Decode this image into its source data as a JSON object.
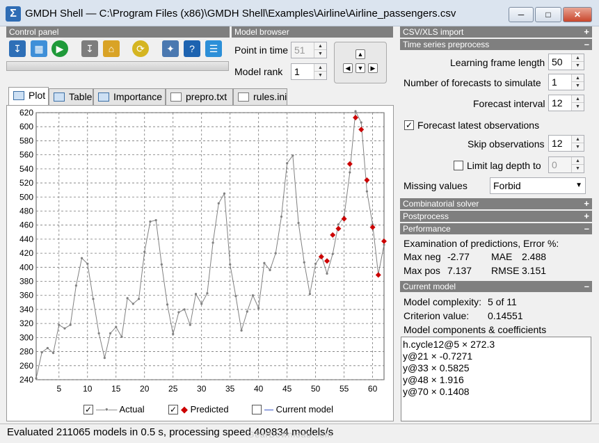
{
  "window": {
    "title": "GMDH Shell — C:\\Program Files (x86)\\GMDH Shell\\Examples\\Airline\\Airline_passengers.csv",
    "app_icon": "Σ"
  },
  "control_panel": {
    "header": "Control panel",
    "icons": [
      "open-icon",
      "dataset-icon",
      "run-icon",
      "export-icon",
      "home-icon",
      "refresh-icon",
      "wizard-icon",
      "help-icon",
      "comment-icon"
    ]
  },
  "model_browser": {
    "header": "Model browser",
    "point_in_time_label": "Point in time",
    "point_in_time_value": "51",
    "model_rank_label": "Model rank",
    "model_rank_value": "1"
  },
  "tabs": [
    {
      "label": "Plot",
      "active": true
    },
    {
      "label": "Table"
    },
    {
      "label": "Importance"
    },
    {
      "label": "prepro.txt"
    },
    {
      "label": "rules.ini"
    }
  ],
  "chart_data": {
    "type": "line",
    "ylim": [
      240,
      620
    ],
    "xlim": [
      1,
      62
    ],
    "y_ticks": [
      "240",
      "260",
      "280",
      "300",
      "320",
      "340",
      "360",
      "380",
      "400",
      "420",
      "440",
      "460",
      "480",
      "500",
      "520",
      "540",
      "560",
      "580",
      "600",
      "620"
    ],
    "x_ticks": [
      "5",
      "10",
      "15",
      "20",
      "25",
      "30",
      "35",
      "40",
      "45",
      "50",
      "55",
      "60"
    ],
    "grid": true,
    "legend_position": "bottom",
    "series": [
      {
        "name": "Actual",
        "color": "#808080",
        "x": [
          1,
          2,
          3,
          4,
          5,
          6,
          7,
          8,
          9,
          10,
          11,
          12,
          13,
          14,
          15,
          16,
          17,
          18,
          19,
          20,
          21,
          22,
          23,
          24,
          25,
          26,
          27,
          28,
          29,
          30,
          31,
          32,
          33,
          34,
          35,
          36,
          37,
          38,
          39,
          40,
          41,
          42,
          43,
          44,
          45,
          46,
          47,
          48,
          49,
          50,
          51,
          52,
          53,
          54,
          55,
          56,
          57,
          58,
          59,
          60,
          61,
          62
        ],
        "y": [
          242,
          279,
          285,
          278,
          318,
          313,
          318,
          374,
          413,
          405,
          355,
          306,
          271,
          306,
          315,
          301,
          356,
          348,
          355,
          422,
          465,
          467,
          404,
          347,
          305,
          336,
          340,
          318,
          362,
          348,
          363,
          435,
          491,
          505,
          404,
          359,
          310,
          337,
          360,
          342,
          406,
          396,
          420,
          472,
          548,
          559,
          463,
          407,
          362,
          405,
          417,
          391,
          419,
          461,
          472,
          535,
          622,
          606,
          508,
          461,
          390,
          432
        ]
      },
      {
        "name": "Predicted",
        "color": "#cc0000",
        "x": [
          51,
          52,
          53,
          54,
          55,
          56,
          57,
          58,
          59,
          60,
          61,
          62
        ],
        "y": [
          415,
          409,
          446,
          455,
          469,
          547,
          613,
          596,
          524,
          457,
          389,
          437
        ]
      },
      {
        "name": "Current model",
        "color": "#1f3fbf",
        "x": [],
        "y": []
      }
    ],
    "legend": [
      {
        "label": "Actual",
        "checked": true
      },
      {
        "label": "Predicted",
        "checked": true
      },
      {
        "label": "Current model",
        "checked": false
      }
    ]
  },
  "right_panel": {
    "csv_import": "CSV/XLS import",
    "ts_preprocess": "Time series preprocess",
    "learning_frame_label": "Learning frame length",
    "learning_frame_value": "50",
    "num_forecasts_label": "Number of forecasts to simulate",
    "num_forecasts_value": "1",
    "forecast_interval_label": "Forecast interval",
    "forecast_interval_value": "12",
    "forecast_latest_label": "Forecast latest observations",
    "skip_obs_label": "Skip observations",
    "skip_obs_value": "12",
    "limit_lag_label": "Limit lag depth to",
    "limit_lag_value": "0",
    "missing_values_label": "Missing values",
    "missing_values_value": "Forbid",
    "combinatorial_solver": "Combinatorial solver",
    "postprocess": "Postprocess",
    "performance": "Performance",
    "perf_title": "Examination of predictions, Error %:",
    "max_neg_label": "Max neg",
    "max_neg_value": "-2.77",
    "mae_label": "MAE",
    "mae_value": "2.488",
    "max_pos_label": "Max pos",
    "max_pos_value": "7.137",
    "rmse_label": "RMSE",
    "rmse_value": "3.151",
    "current_model": "Current model",
    "complexity_label": "Model complexity:",
    "complexity_value": "5 of 11",
    "criterion_label": "Criterion value:",
    "criterion_value": "0.14551",
    "components_label": "Model components & coefficients",
    "coefficients": [
      "h.cycle12@5 ×  272.3",
      "y@21 ×  -0.7271",
      "y@33 ×  0.5825",
      "y@48 ×  1.916",
      "y@70 ×  0.1408"
    ]
  },
  "status": {
    "text": "Evaluated 211065 models in 0.5 s, processing speed 409834 models/s"
  },
  "watermark": "GearDownload.com"
}
